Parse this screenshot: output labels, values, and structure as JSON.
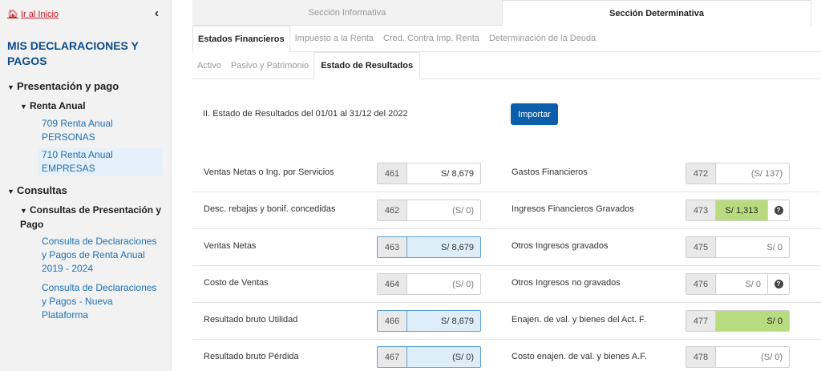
{
  "sidebar": {
    "home_label": "Ir al Inicio",
    "title": "MIS DECLARACIONES Y PAGOS",
    "presentacion": "Presentación y pago",
    "renta_anual": "Renta Anual",
    "item_709": "709 Renta Anual PERSONAS",
    "item_710": "710 Renta Anual EMPRESAS",
    "consultas": "Consultas",
    "consultas_pres": "Consultas de Presentación y Pago",
    "consulta_1": "Consulta de Declaraciones y Pagos de Renta Anual 2019 - 2024",
    "consulta_2": "Consulta de Declaraciones y Pagos - Nueva Plataforma"
  },
  "section_tabs": [
    "Sección Informativa",
    "Sección Determinativa"
  ],
  "tabs": [
    "Estados Financieros",
    "Impuesto a la Renta",
    "Cred. Contra Imp. Renta",
    "Determinación de la Deuda"
  ],
  "subtabs": [
    "Activo",
    "Pasivo y Patrimonio",
    "Estado de Resultados"
  ],
  "period_text": "II. Estado de Resultados del 01/01 al 31/12 del 2022",
  "import_label": "Importar",
  "rows_left": [
    {
      "label": "Ventas Netas o Ing. por Servicios",
      "code": "461",
      "value": "S/ 8,679"
    },
    {
      "label": "Desc. rebajas y bonif. concedidas",
      "code": "462",
      "value": "(S/ 0)"
    },
    {
      "label": "Ventas Netas",
      "code": "463",
      "value": "S/ 8,679"
    },
    {
      "label": "Costo de Ventas",
      "code": "464",
      "value": "(S/ 0)"
    },
    {
      "label": "Resultado bruto Utilidad",
      "code": "466",
      "value": "S/ 8,679"
    },
    {
      "label": "Resultado bruto Pérdida",
      "code": "467",
      "value": "(S/ 0)"
    }
  ],
  "rows_right": [
    {
      "label": "Gastos Financieros",
      "code": "472",
      "value": "(S/ 137)"
    },
    {
      "label": "Ingresos Financieros Gravados",
      "code": "473",
      "value": "S/ 1,313"
    },
    {
      "label": "Otros Ingresos gravados",
      "code": "475",
      "value": "S/ 0"
    },
    {
      "label": "Otros Ingresos no gravados",
      "code": "476",
      "value": "S/ 0"
    },
    {
      "label": "Enajen. de val. y bienes del Act. F.",
      "code": "477",
      "value": "S/ 0"
    },
    {
      "label": "Costo enajen. de val. y bienes A.F.",
      "code": "478",
      "value": "(S/ 0)"
    }
  ],
  "colors": {
    "accent": "#0b5eaa",
    "title": "#0b4b8a",
    "home_link": "#c4161c",
    "highlight_green": "#b9db7f",
    "highlight_blue": "#ddeef9"
  }
}
